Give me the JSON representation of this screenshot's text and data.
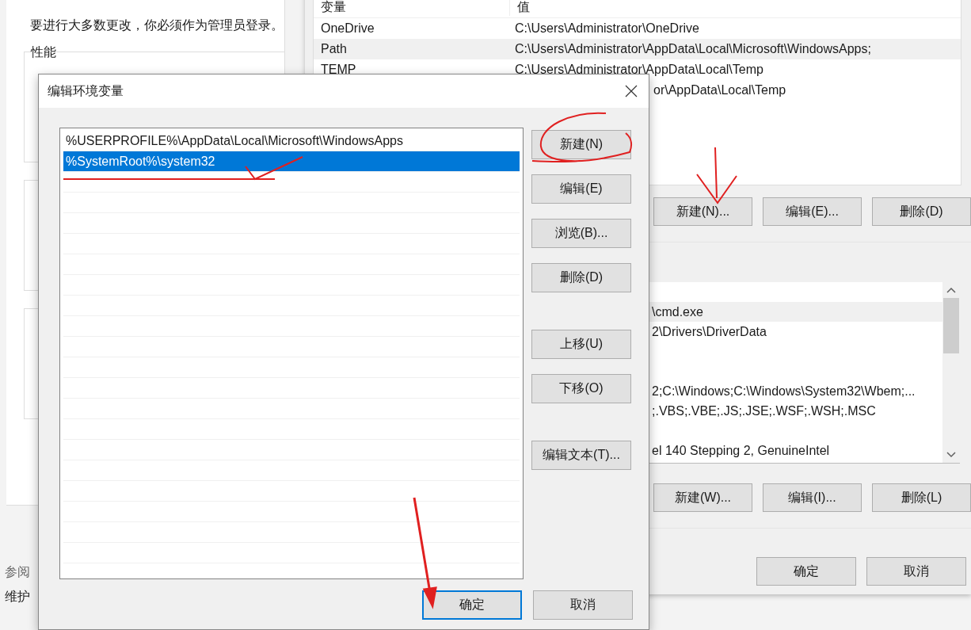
{
  "background_window": {
    "notice": "要进行大多数更改，你必须作为管理员登录。",
    "groups": [
      "性能"
    ],
    "links": [
      "参阅",
      "维护"
    ]
  },
  "env_window": {
    "user_vars": {
      "columns": [
        "变量",
        "值"
      ],
      "rows": [
        {
          "name": "OneDrive",
          "value": "C:\\Users\\Administrator\\OneDrive",
          "selected": false
        },
        {
          "name": "Path",
          "value": "C:\\Users\\Administrator\\AppData\\Local\\Microsoft\\WindowsApps;",
          "selected": true
        },
        {
          "name": "TEMP",
          "value": "C:\\Users\\Administrator\\AppData\\Local\\Temp",
          "selected": false
        },
        {
          "value": "or\\AppData\\Local\\Temp",
          "selected": false
        }
      ]
    },
    "user_buttons": [
      "新建(N)...",
      "编辑(E)...",
      "删除(D)"
    ],
    "system_vars": {
      "rows": [
        {
          "selected": false
        },
        {
          "value": "\\cmd.exe",
          "selected": true
        },
        {
          "value": "2\\Drivers\\DriverData",
          "selected": false
        },
        {
          "selected": false
        },
        {
          "selected": false
        },
        {
          "value": "2;C:\\Windows;C:\\Windows\\System32\\Wbem;...",
          "selected": false
        },
        {
          "value": ";.VBS;.VBE;.JS;.JSE;.WSF;.WSH;.MSC",
          "selected": false
        },
        {
          "selected": false
        },
        {
          "value": "el 140 Stepping 2, GenuineIntel",
          "selected": false
        }
      ]
    },
    "system_buttons": [
      "新建(W)...",
      "编辑(I)...",
      "删除(L)"
    ],
    "footer_buttons": [
      "确定",
      "取消"
    ]
  },
  "dialog": {
    "title": "编辑环境变量",
    "entries": [
      {
        "text": "%USERPROFILE%\\AppData\\Local\\Microsoft\\WindowsApps",
        "selected": false
      },
      {
        "text": "%SystemRoot%\\system32",
        "selected": true
      }
    ],
    "side_buttons": [
      [
        "新建(N)",
        "编辑(E)",
        "浏览(B)...",
        "删除(D)"
      ],
      [
        "上移(U)",
        "下移(O)"
      ],
      [
        "编辑文本(T)..."
      ]
    ],
    "footer_buttons": [
      {
        "label": "确定",
        "default": true
      },
      {
        "label": "取消",
        "default": false
      }
    ]
  }
}
